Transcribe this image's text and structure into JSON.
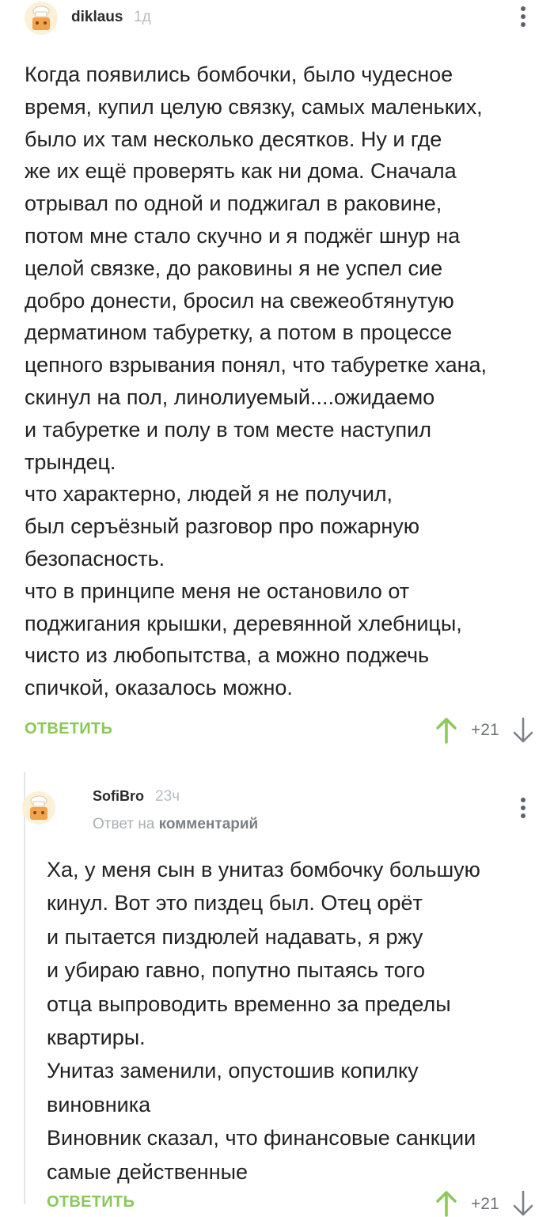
{
  "comments": [
    {
      "author": "diklaus",
      "time": "1д",
      "text": "Когда появились бомбочки, было чудесное\nвремя, купил целую связку, самых маленьких,\nбыло их там несколько десятков. Ну и где\nже их ещё проверять как ни дома. Сначала\nотрывал по одной и поджигал в раковине,\nпотом мне стало скучно и я поджёг шнур на\nцелой связке, до раковины я не успел сие\nдобро донести, бросил на свежеобтянутую\nдерматином табуретку, а потом в процессе\nцепного взрывания понял, что табуретке хана,\nскинул на пол, линолиуемый....ожидаемо\nи табуретке и полу в том месте наступил\nтрындец.\nчто характерно, людей я не получил,\nбыл серъёзный разговор про пожарную\nбезопасность.\nчто в принципе меня не остановило от\nподжигания крышки, деревянной хлебницы,\nчисто из любопытства, а можно поджечь\nспичкой, оказалось можно.",
      "reply_label": "ОТВЕТИТЬ",
      "rating": "+21"
    },
    {
      "author": "SofiBro",
      "time": "23ч",
      "reply_to_prefix": "Ответ на",
      "reply_to_link": "комментарий",
      "text": "Ха, у меня сын в унитаз бомбочку большую\nкинул. Вот это пиздец был. Отец орёт\nи пытается пиздюлей надавать, я ржу\nи убираю гавно, попутно пытаясь того\nотца выпроводить временно за пределы\nквартиры.\nУнитаз заменили, опустошив копилку\nвиновника\nВиновник сказал, что финансовые санкции\nсамые действенные",
      "reply_label": "ОТВЕТИТЬ",
      "rating": "+21"
    }
  ],
  "colors": {
    "accent_green": "#8ac858",
    "muted": "#b7bcc2",
    "text": "#222222"
  },
  "icons": [
    "avatar-chef-icon",
    "more-vertical-icon",
    "arrow-up-icon",
    "arrow-down-icon"
  ]
}
